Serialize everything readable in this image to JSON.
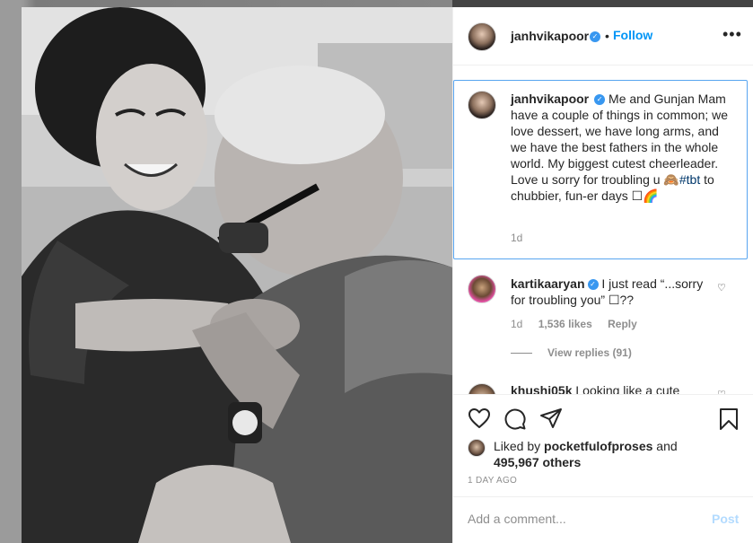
{
  "post": {
    "username": "janhvikapoor",
    "follow_label": "Follow",
    "dot": "•",
    "more_label": "•••"
  },
  "caption": {
    "username": "janhvikapoor",
    "text": "Me and Gunjan Mam have a couple of things in common; we love dessert, we have long arms, and we have the best fathers in the whole world. My biggest cutest cheerleader. Love u sorry for troubling u 🙈",
    "hashtag": "#tbt",
    "text_after": " to chubbier, fun-er days ☐🌈",
    "time": "1d"
  },
  "comments": [
    {
      "username": "kartikaaryan",
      "text": "I just read “...sorry for troubling you” ☐??",
      "time": "1d",
      "likes": "1,536 likes",
      "reply_label": "Reply",
      "view_replies": "View replies (91)"
    },
    {
      "username": "khushi05k",
      "text": "Looking like a cute"
    }
  ],
  "likes": {
    "prefix": "Liked by ",
    "user": "pocketfulofproses",
    "middle": " and",
    "count": "495,967 others"
  },
  "post_time": "1 DAY AGO",
  "add_comment": {
    "placeholder": "Add a comment...",
    "post_label": "Post"
  },
  "icons": {
    "heart": "heart-icon",
    "comment": "comment-icon",
    "share": "share-icon",
    "save": "bookmark-icon",
    "verified": "verified-badge-icon"
  },
  "colors": {
    "accent": "#0095f6",
    "post_disabled": "#b3dbff",
    "caption_border": "#58a5f0",
    "verified": "#3897f0"
  }
}
